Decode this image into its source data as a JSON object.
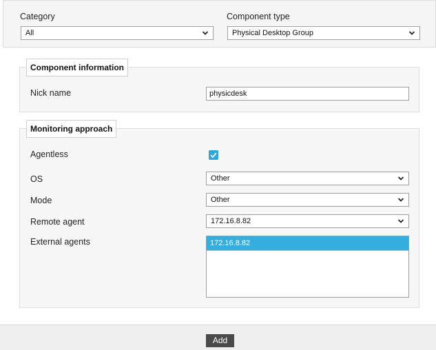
{
  "header": {
    "category_label": "Category",
    "category_value": "All",
    "component_type_label": "Component type",
    "component_type_value": "Physical Desktop Group"
  },
  "component_information": {
    "legend": "Component information",
    "nick_name_label": "Nick name",
    "nick_name_value": "physicdesk"
  },
  "monitoring_approach": {
    "legend": "Monitoring approach",
    "agentless_label": "Agentless",
    "agentless_checked": true,
    "os_label": "OS",
    "os_value": "Other",
    "mode_label": "Mode",
    "mode_value": "Other",
    "remote_agent_label": "Remote agent",
    "remote_agent_value": "172.16.8.82",
    "external_agents_label": "External agents",
    "external_agents": [
      "172.16.8.82"
    ]
  },
  "footer": {
    "add_label": "Add"
  },
  "colors": {
    "accent": "#34aede",
    "button": "#4a4a4a"
  },
  "icons": {
    "dropdown": "chevron-down-icon",
    "checkbox": "checkmark-icon"
  }
}
